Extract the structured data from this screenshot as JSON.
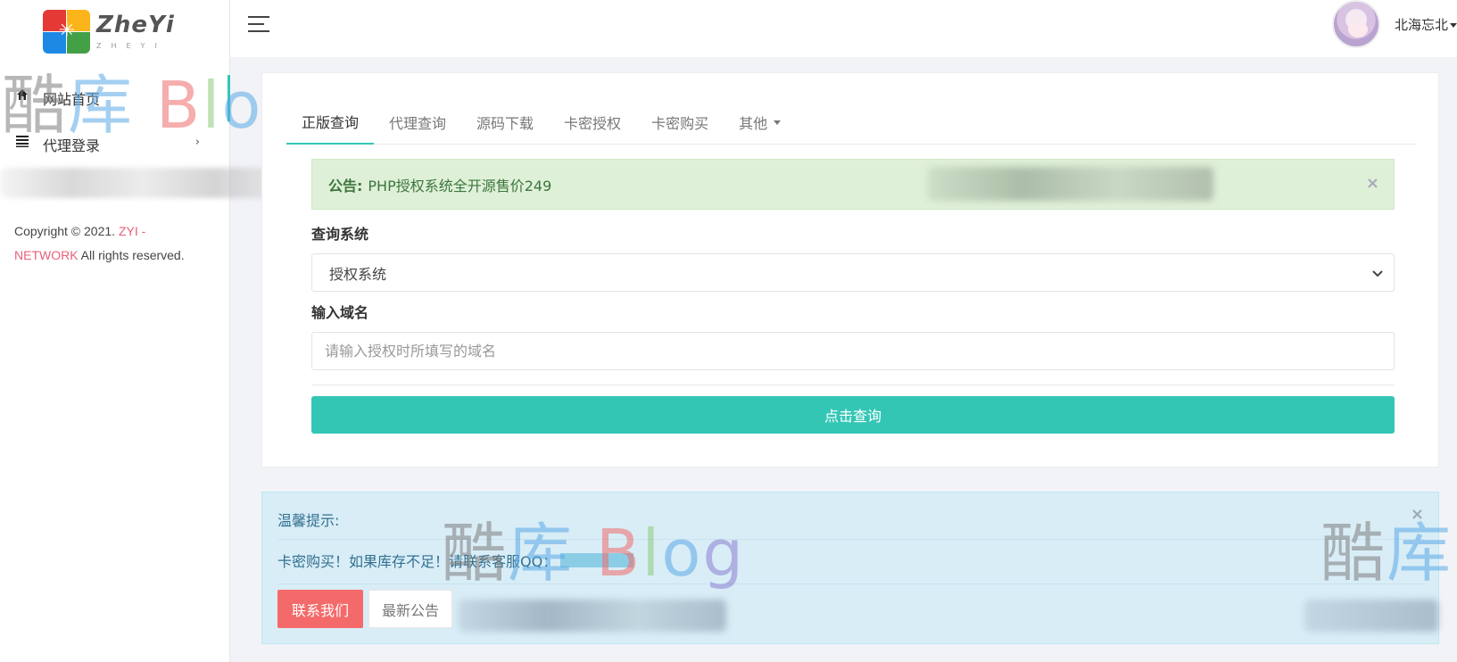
{
  "brand": {
    "logo_title": "ZheYi",
    "logo_subtitle": "ZHEYI"
  },
  "sidebar": {
    "items": [
      {
        "label": "网站首页",
        "icon": "home-icon",
        "active": true
      },
      {
        "label": "代理登录",
        "icon": "list-icon",
        "has_submenu": true
      }
    ],
    "copyright": {
      "prefix": "Copyright © 2021. ",
      "link_text": "ZYI - NETWORK",
      "suffix": " All rights reserved."
    }
  },
  "topbar": {
    "username": "北海忘北"
  },
  "tabs": [
    {
      "label": "正版查询",
      "active": true
    },
    {
      "label": "代理查询"
    },
    {
      "label": "源码下载"
    },
    {
      "label": "卡密授权"
    },
    {
      "label": "卡密购买"
    },
    {
      "label": "其他",
      "dropdown": true
    }
  ],
  "notice": {
    "label": "公告:",
    "text": "PHP授权系统全开源售价249",
    "close": "×"
  },
  "form": {
    "system_label": "查询系统",
    "system_value": "授权系统",
    "domain_label": "输入域名",
    "domain_placeholder": "请输入授权时所填写的域名",
    "submit_label": "点击查询"
  },
  "tip": {
    "title": "温馨提示:",
    "message": "卡密购买！如果库存不足！请联系客服QQ：",
    "close": "×",
    "contact_label": "联系我们",
    "news_label": "最新公告"
  },
  "watermark": {
    "cn": "酷库",
    "en": "Blog"
  },
  "colors": {
    "accent": "#34c6b5",
    "success_bg": "#dff0d8",
    "success_text": "#3c763d",
    "info_bg": "#d9edf7",
    "info_text": "#31708f",
    "danger": "#f46a6a",
    "link": "#e8607a"
  }
}
